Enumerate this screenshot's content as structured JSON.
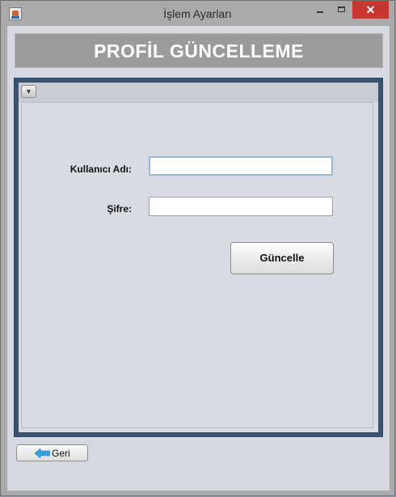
{
  "window": {
    "title": "İşlem Ayarları",
    "close_symbol": "✕",
    "icons": [
      "java-app-icon",
      "minimize-icon",
      "maximize-icon",
      "close-icon"
    ]
  },
  "header": {
    "title": "PROFİL GÜNCELLEME"
  },
  "form": {
    "collapse_icon": "▼",
    "username_label": "Kullanıcı Adı:",
    "username_value": "",
    "password_label": "Şifre:",
    "password_value": "",
    "update_button": "Güncelle"
  },
  "footer": {
    "back_button": "Geri",
    "back_icon": "arrow-left-icon"
  },
  "colors": {
    "header_bg": "#9b9b9b",
    "frame_border": "#3a5470",
    "panel_bg": "#d9dbe2",
    "close_button": "#c7372f",
    "back_arrow": "#3aa0e0"
  }
}
